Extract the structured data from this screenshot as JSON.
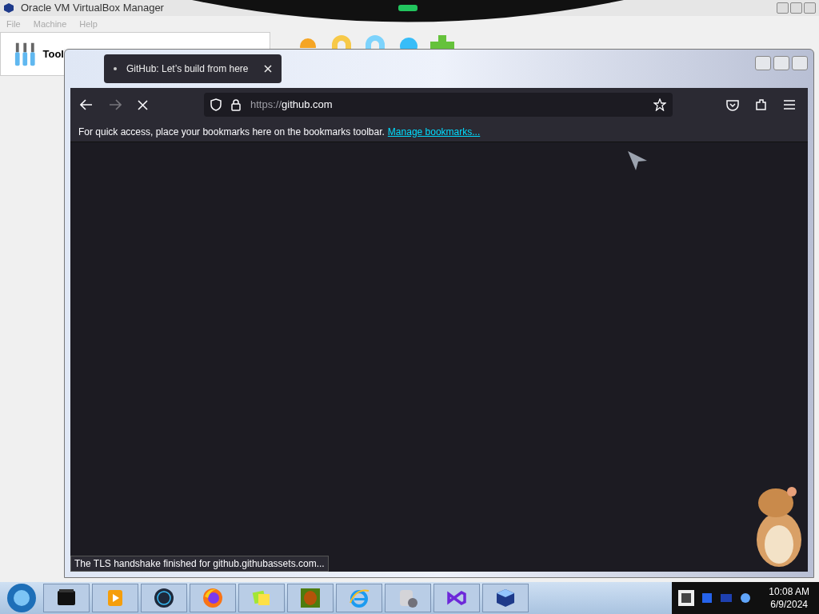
{
  "vbox": {
    "title": "Oracle VM VirtualBox Manager",
    "menu": [
      "File",
      "Machine",
      "Help"
    ],
    "tools_label": "Tool"
  },
  "browser": {
    "tab": {
      "title": "GitHub: Let’s build from here",
      "selected": true
    },
    "loading": true,
    "url_scheme": "https://",
    "url_host": "github.com",
    "bookmarks_hint": "For quick access, place your bookmarks here on the bookmarks toolbar.",
    "bookmarks_link": "Manage bookmarks...",
    "status": "The TLS handshake finished for github.githubassets.com..."
  },
  "taskbar": {
    "items": [
      {
        "kind": "terminal"
      },
      {
        "kind": "media"
      },
      {
        "kind": "globe"
      },
      {
        "kind": "firefox"
      },
      {
        "kind": "notes"
      },
      {
        "kind": "game"
      },
      {
        "kind": "ie"
      },
      {
        "kind": "disk"
      },
      {
        "kind": "vs"
      },
      {
        "kind": "vbox"
      }
    ],
    "clock": {
      "time": "10:08 AM",
      "date": "6/9/2024"
    }
  }
}
